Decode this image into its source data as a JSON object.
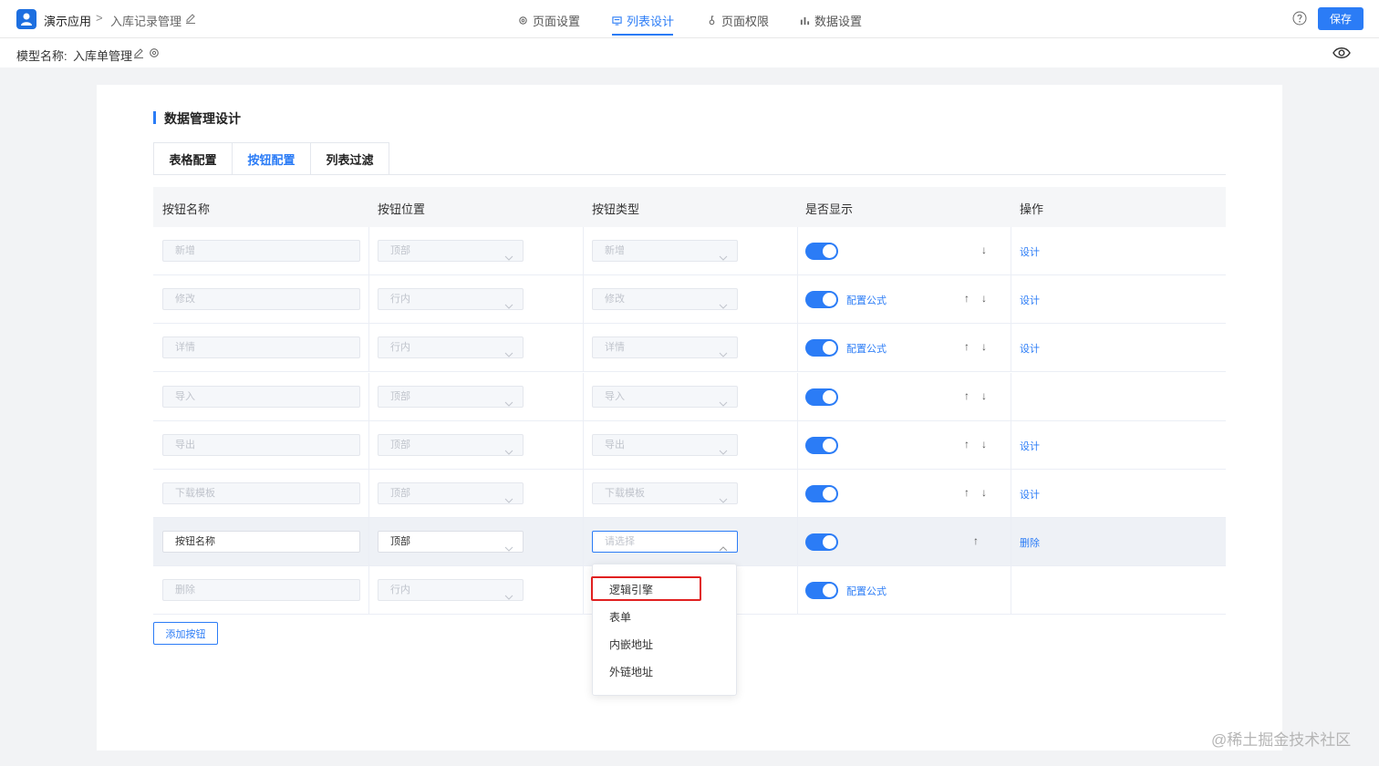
{
  "header": {
    "app_name": "演示应用",
    "breadcrumb_sep": ">",
    "page_name": "入库记录管理",
    "nav_tabs": [
      {
        "label": "页面设置",
        "icon": "gear-icon"
      },
      {
        "label": "列表设计",
        "icon": "list-design-icon"
      },
      {
        "label": "页面权限",
        "icon": "key-icon"
      },
      {
        "label": "数据设置",
        "icon": "bar-chart-icon"
      }
    ],
    "active_tab_index": 1,
    "save_label": "保存"
  },
  "model_bar": {
    "label": "模型名称:",
    "name": "入库单管理"
  },
  "section": {
    "title": "数据管理设计",
    "subtabs": [
      "表格配置",
      "按钮配置",
      "列表过滤"
    ],
    "active_subtab_index": 1
  },
  "table": {
    "columns": [
      "按钮名称",
      "按钮位置",
      "按钮类型",
      "是否显示",
      "操作"
    ],
    "rows": [
      {
        "name": "新增",
        "position": "顶部",
        "type": "新增",
        "shown": true,
        "formula": "",
        "up": false,
        "down": true,
        "action": "设计"
      },
      {
        "name": "修改",
        "position": "行内",
        "type": "修改",
        "shown": true,
        "formula": "配置公式",
        "up": true,
        "down": true,
        "action": "设计"
      },
      {
        "name": "详情",
        "position": "行内",
        "type": "详情",
        "shown": true,
        "formula": "配置公式",
        "up": true,
        "down": true,
        "action": "设计"
      },
      {
        "name": "导入",
        "position": "顶部",
        "type": "导入",
        "shown": true,
        "formula": "",
        "up": true,
        "down": true,
        "action": ""
      },
      {
        "name": "导出",
        "position": "顶部",
        "type": "导出",
        "shown": true,
        "formula": "",
        "up": true,
        "down": true,
        "action": "设计"
      },
      {
        "name": "下载模板",
        "position": "顶部",
        "type": "下载模板",
        "shown": true,
        "formula": "",
        "up": true,
        "down": true,
        "action": "设计"
      },
      {
        "name": "按钮名称",
        "position": "顶部",
        "type": "请选择",
        "shown": true,
        "formula": "",
        "up": true,
        "down": false,
        "action": "删除",
        "editing": true
      },
      {
        "name": "删除",
        "position": "行内",
        "type": "",
        "shown": true,
        "formula": "配置公式",
        "up": false,
        "down": false,
        "action": ""
      }
    ],
    "add_button_label": "添加按钮"
  },
  "dropdown": {
    "options": [
      "逻辑引擎",
      "表单",
      "内嵌地址",
      "外链地址"
    ],
    "highlighted_index": 0
  },
  "watermark": "@稀土掘金技术社区",
  "colors": {
    "accent": "#2b7cf6",
    "highlight_box": "#e02020"
  }
}
